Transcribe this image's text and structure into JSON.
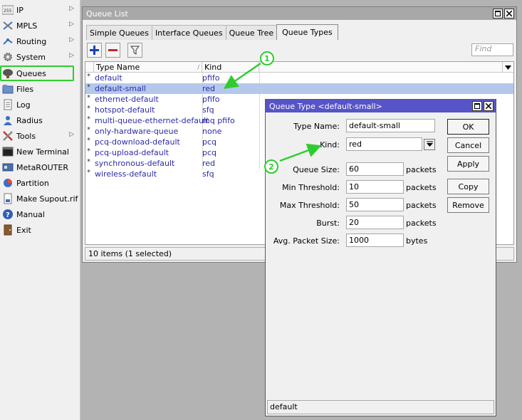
{
  "sidebar": {
    "items": [
      {
        "label": "IP",
        "icon": "ip-icon",
        "has_submenu": true
      },
      {
        "label": "MPLS",
        "icon": "mpls-icon",
        "has_submenu": true
      },
      {
        "label": "Routing",
        "icon": "routing-icon",
        "has_submenu": true
      },
      {
        "label": "System",
        "icon": "system-gear-icon",
        "has_submenu": true
      },
      {
        "label": "Queues",
        "icon": "queues-icon",
        "has_submenu": false,
        "highlighted": true
      },
      {
        "label": "Files",
        "icon": "folder-icon",
        "has_submenu": false
      },
      {
        "label": "Log",
        "icon": "log-icon",
        "has_submenu": false
      },
      {
        "label": "Radius",
        "icon": "radius-icon",
        "has_submenu": false
      },
      {
        "label": "Tools",
        "icon": "tools-icon",
        "has_submenu": true
      },
      {
        "label": "New Terminal",
        "icon": "terminal-icon",
        "has_submenu": false
      },
      {
        "label": "MetaROUTER",
        "icon": "metarouter-icon",
        "has_submenu": false
      },
      {
        "label": "Partition",
        "icon": "partition-icon",
        "has_submenu": false
      },
      {
        "label": "Make Supout.rif",
        "icon": "supout-icon",
        "has_submenu": false
      },
      {
        "label": "Manual",
        "icon": "help-icon",
        "has_submenu": false
      },
      {
        "label": "Exit",
        "icon": "exit-icon",
        "has_submenu": false
      }
    ],
    "ip_glyph": "255",
    "submenu_arrow": "▷"
  },
  "queue_list": {
    "title": "Queue List",
    "tabs": [
      {
        "label": "Simple Queues",
        "active": false
      },
      {
        "label": "Interface Queues",
        "active": false
      },
      {
        "label": "Queue Tree",
        "active": false
      },
      {
        "label": "Queue Types",
        "active": true
      }
    ],
    "find_placeholder": "Find",
    "columns": [
      "Type Name",
      "Kind"
    ],
    "rows": [
      {
        "mark": "*",
        "name": "default",
        "kind": "pfifo",
        "selected": false
      },
      {
        "mark": "*",
        "name": "default-small",
        "kind": "red",
        "selected": true
      },
      {
        "mark": "*",
        "name": "ethernet-default",
        "kind": "pfifo",
        "selected": false
      },
      {
        "mark": "*",
        "name": "hotspot-default",
        "kind": "sfq",
        "selected": false
      },
      {
        "mark": "*",
        "name": "multi-queue-ethernet-default",
        "kind": "mq pfifo",
        "selected": false
      },
      {
        "mark": "*",
        "name": "only-hardware-queue",
        "kind": "none",
        "selected": false
      },
      {
        "mark": "*",
        "name": "pcq-download-default",
        "kind": "pcq",
        "selected": false
      },
      {
        "mark": "*",
        "name": "pcq-upload-default",
        "kind": "pcq",
        "selected": false
      },
      {
        "mark": "*",
        "name": "synchronous-default",
        "kind": "red",
        "selected": false
      },
      {
        "mark": "*",
        "name": "wireless-default",
        "kind": "sfq",
        "selected": false
      }
    ],
    "status": "10 items (1 selected)"
  },
  "dialog": {
    "title": "Queue Type <default-small>",
    "fields": {
      "type_name": {
        "label": "Type Name:",
        "value": "default-small"
      },
      "kind": {
        "label": "Kind:",
        "value": "red"
      },
      "queue_size": {
        "label": "Queue Size:",
        "value": "60",
        "unit": "packets"
      },
      "min_threshold": {
        "label": "Min Threshold:",
        "value": "10",
        "unit": "packets"
      },
      "max_threshold": {
        "label": "Max Threshold:",
        "value": "50",
        "unit": "packets"
      },
      "burst": {
        "label": "Burst:",
        "value": "20",
        "unit": "packets"
      },
      "avg_packet_size": {
        "label": "Avg. Packet Size:",
        "value": "1000",
        "unit": "bytes"
      }
    },
    "buttons": {
      "ok": "OK",
      "cancel": "Cancel",
      "apply": "Apply",
      "copy": "Copy",
      "remove": "Remove"
    },
    "status": "default"
  },
  "annotations": {
    "badge1": "1",
    "badge2": "2",
    "color": "#2fcc2f"
  },
  "colors": {
    "selected_row": "#b4c8ec",
    "link_text": "#2c2ca8",
    "dialog_title": "#5654c6"
  }
}
